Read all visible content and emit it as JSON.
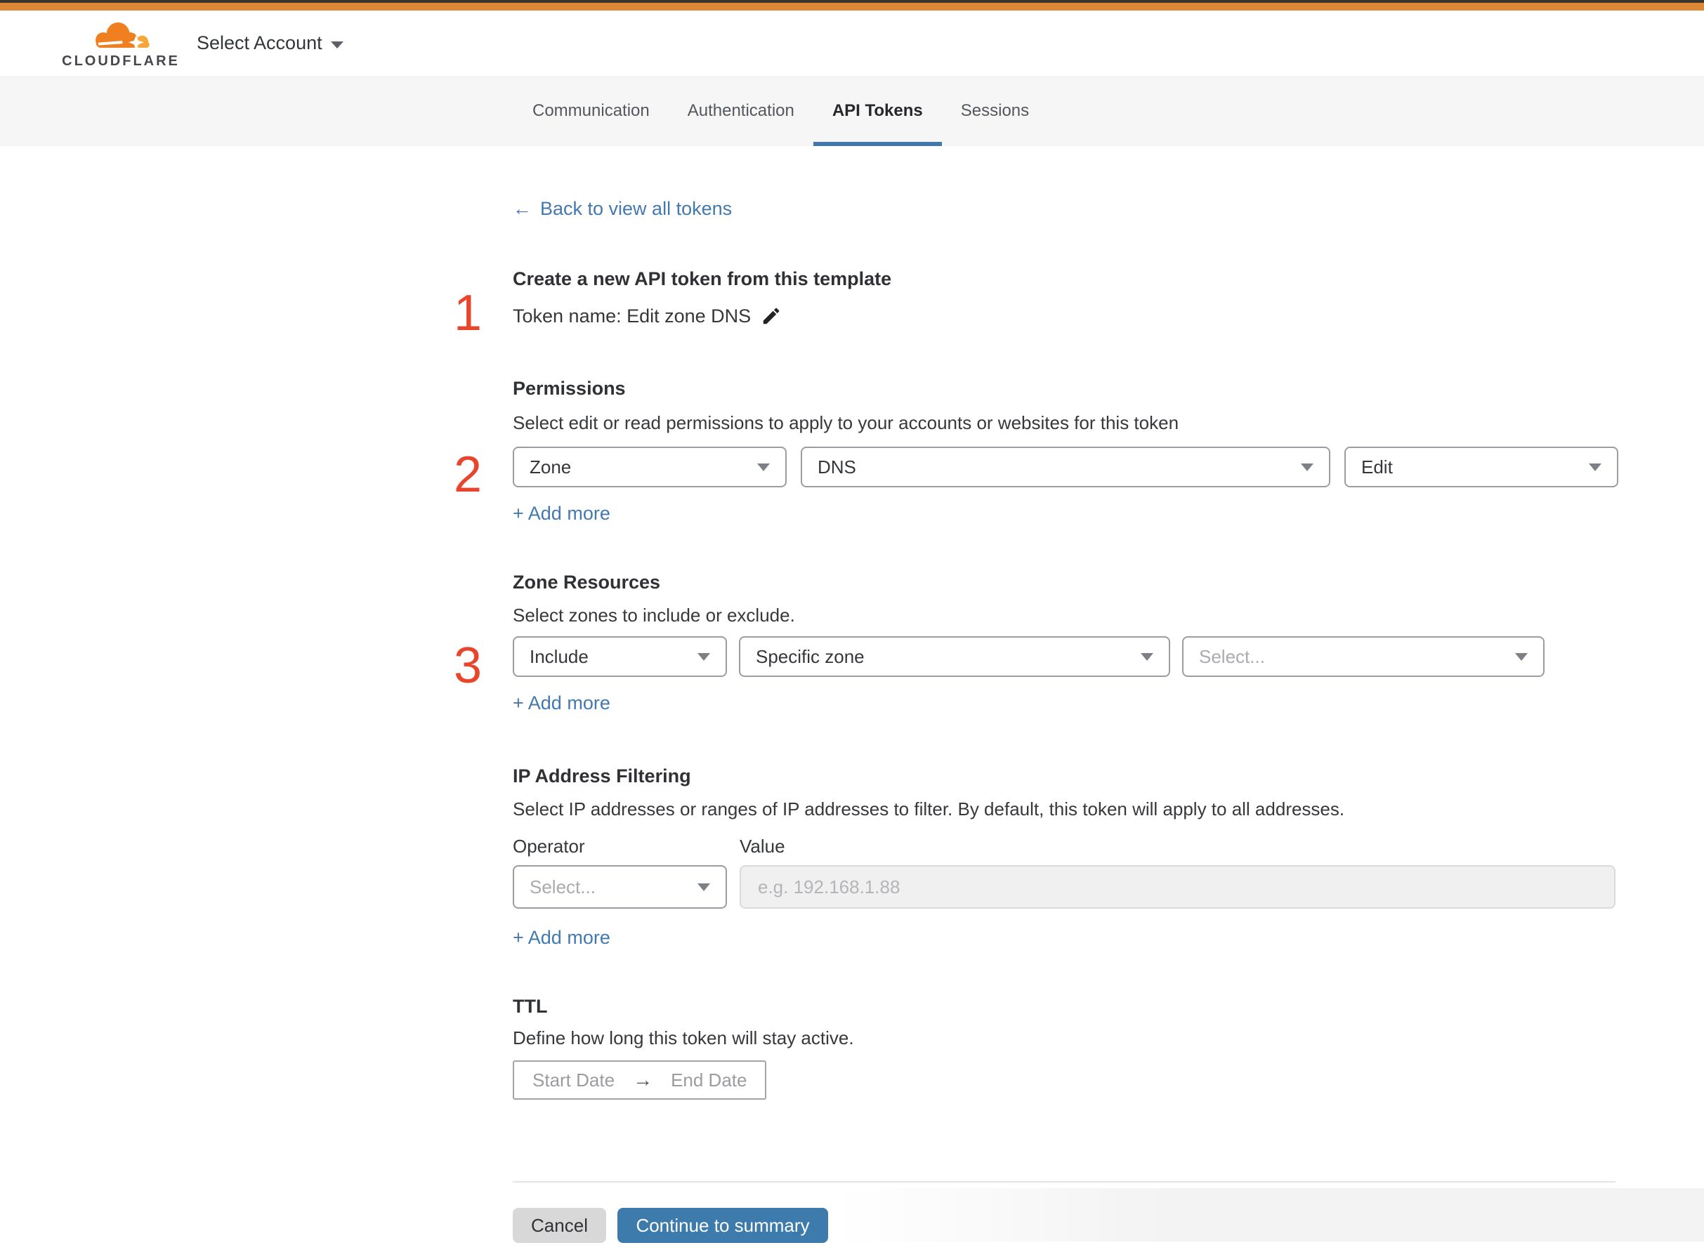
{
  "header": {
    "logo": "CLOUDFLARE",
    "account_selector": "Select Account"
  },
  "nav": {
    "tabs": [
      "Communication",
      "Authentication",
      "API Tokens",
      "Sessions"
    ],
    "active_tab": "API Tokens"
  },
  "page": {
    "back_arrow": "←",
    "back_label": "Back to view all tokens"
  },
  "template": {
    "step": "1",
    "title": "Create a new API token from this template",
    "token_name": "Token name: Edit zone DNS"
  },
  "permissions": {
    "step": "2",
    "title": "Permissions",
    "description": "Select edit or read permissions to apply to your accounts or websites for this token",
    "scope": "Zone",
    "resource": "DNS",
    "access": "Edit",
    "add_more": "+ Add more"
  },
  "zone_resources": {
    "step": "3",
    "title": "Zone Resources",
    "description": "Select zones to include or exclude.",
    "mode": "Include",
    "type": "Specific zone",
    "zone_placeholder": "Select...",
    "add_more": "+ Add more"
  },
  "ip_filtering": {
    "title": "IP Address Filtering",
    "description": "Select IP addresses or ranges of IP addresses to filter. By default, this token will apply to all addresses.",
    "operator_label": "Operator",
    "value_label": "Value",
    "operator_placeholder": "Select...",
    "value_placeholder": "e.g. 192.168.1.88",
    "add_more": "+ Add more"
  },
  "ttl": {
    "title": "TTL",
    "description": "Define how long this token will stay active.",
    "start_date": "Start Date",
    "arrow": "→",
    "end_date": "End Date"
  },
  "footer": {
    "cancel": "Cancel",
    "continue_label": "Continue to summary"
  },
  "colors": {
    "top_bar_orange": "#dd8737",
    "brand_orange": "#ef7f1f",
    "brand_gold": "#f5a839",
    "step_marker_red": "#e8452c",
    "link_blue": "#4379ae",
    "button_blue": "#3d7bad",
    "tab_underline_blue": "#4478a9"
  }
}
